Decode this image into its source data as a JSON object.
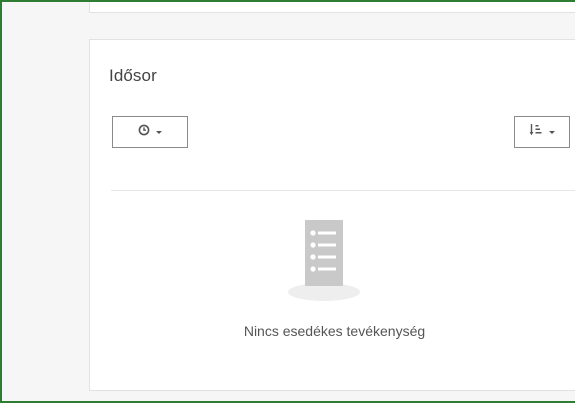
{
  "timeline": {
    "title": "Idősor",
    "filter_button": {
      "icon": "clock-icon"
    },
    "sort_button": {
      "icon": "sort-descending-icon"
    },
    "empty_state": {
      "icon": "list-document-icon",
      "message": "Nincs esedékes tevékenység"
    }
  },
  "colors": {
    "frame_border": "#2e7d32",
    "panel_background": "#ffffff",
    "page_background": "#f6f6f6",
    "icon_gray": "#c9c9c9"
  }
}
